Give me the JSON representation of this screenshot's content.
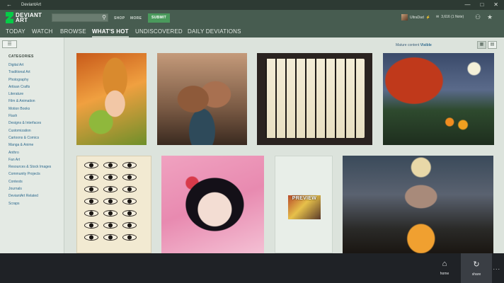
{
  "window": {
    "title": "DeviantArt",
    "back_glyph": "←",
    "minimize_glyph": "—",
    "maximize_glyph": "□",
    "close_glyph": "✕"
  },
  "header": {
    "logo_line1": "DEVIANT",
    "logo_line2": "ART",
    "search_placeholder": "",
    "search_icon": "search-icon",
    "shop_label": "SHOP",
    "more_label": "MORE",
    "submit_label": "SUBMIT",
    "username": "UltraDad",
    "notes_text": "3,616 (1 Note)",
    "icons": [
      "lightning-icon",
      "mail-icon",
      "friends-icon",
      "star-icon"
    ]
  },
  "tabs": [
    {
      "label": "TODAY"
    },
    {
      "label": "WATCH"
    },
    {
      "label": "BROWSE"
    },
    {
      "label": "WHAT'S HOT",
      "active": true
    },
    {
      "label": "UNDISCOVERED"
    },
    {
      "label": "DAILY DEVIATIONS"
    }
  ],
  "sidebar": {
    "toggle_icon": "menu-icon",
    "heading": "CATEGORIES",
    "categories": [
      "Digital Art",
      "Traditional Art",
      "Photography",
      "Artisan Crafts",
      "Literature",
      "Film & Animation",
      "Motion Books",
      "Flash",
      "Designs & Interfaces",
      "Customization",
      "Cartoons & Comics",
      "Manga & Anime",
      "Anthro",
      "Fan Art",
      "Resources & Stock Images",
      "Community Projects",
      "Contests",
      "Journals",
      "DeviantArt Related",
      "Scraps"
    ]
  },
  "content": {
    "mature_label": "Mature content",
    "mature_value": "Visible",
    "preview_label": "PREVIEW",
    "view_icons": [
      "grid-view-icon",
      "list-view-icon"
    ]
  },
  "appbar": {
    "home_label": "home",
    "share_label": "share",
    "more_glyph": "..."
  },
  "colors": {
    "header": "#475c50",
    "accent_green": "#05cc47",
    "link": "#2e6a8e",
    "appbar": "#1f2226"
  }
}
